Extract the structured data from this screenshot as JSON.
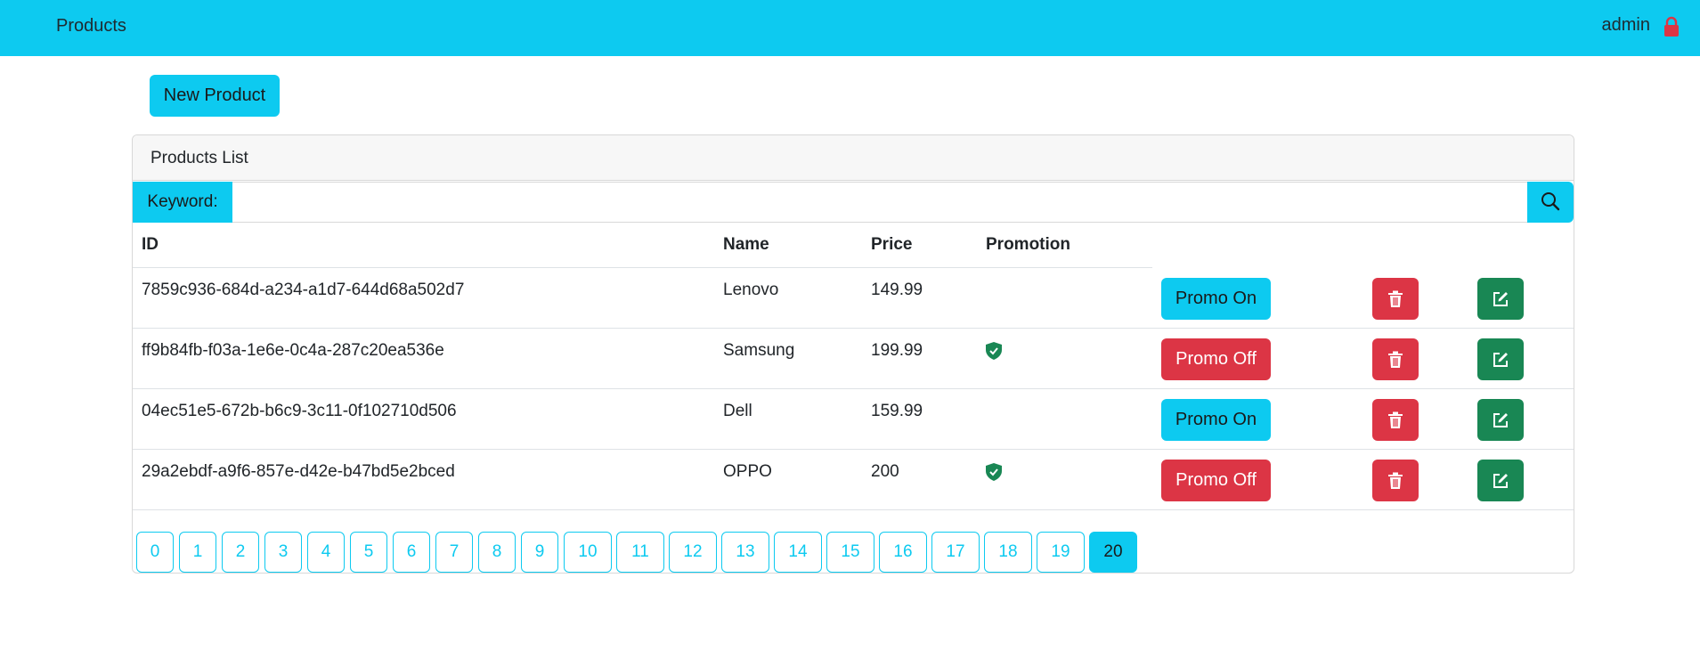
{
  "navbar": {
    "brand": "Products",
    "user": "admin",
    "logout_icon": "lock-icon"
  },
  "new_product_label": "New Product",
  "card": {
    "title": "Products List",
    "search": {
      "label": "Keyword:",
      "value": "",
      "placeholder": "",
      "icon": "search-icon"
    },
    "columns": [
      "ID",
      "Name",
      "Price",
      "Promotion"
    ],
    "rows": [
      {
        "id": "7859c936-684d-a234-a1d7-644d68a502d7",
        "name": "Lenovo",
        "price": "149.99",
        "promotion": false,
        "promo_label": "Promo On"
      },
      {
        "id": "ff9b84fb-f03a-1e6e-0c4a-287c20ea536e",
        "name": "Samsung",
        "price": "199.99",
        "promotion": true,
        "promo_label": "Promo Off"
      },
      {
        "id": "04ec51e5-672b-b6c9-3c11-0f102710d506",
        "name": "Dell",
        "price": "159.99",
        "promotion": false,
        "promo_label": "Promo On"
      },
      {
        "id": "29a2ebdf-a9f6-857e-d42e-b47bd5e2bced",
        "name": "OPPO",
        "price": "200",
        "promotion": true,
        "promo_label": "Promo Off"
      }
    ],
    "pagination": {
      "pages": [
        "0",
        "1",
        "2",
        "3",
        "4",
        "5",
        "6",
        "7",
        "8",
        "9",
        "10",
        "11",
        "12",
        "13",
        "14",
        "15",
        "16",
        "17",
        "18",
        "19",
        "20"
      ],
      "current": "20"
    }
  },
  "colors": {
    "primary": "#0dcaf0",
    "danger": "#dc3545",
    "success": "#198754"
  }
}
